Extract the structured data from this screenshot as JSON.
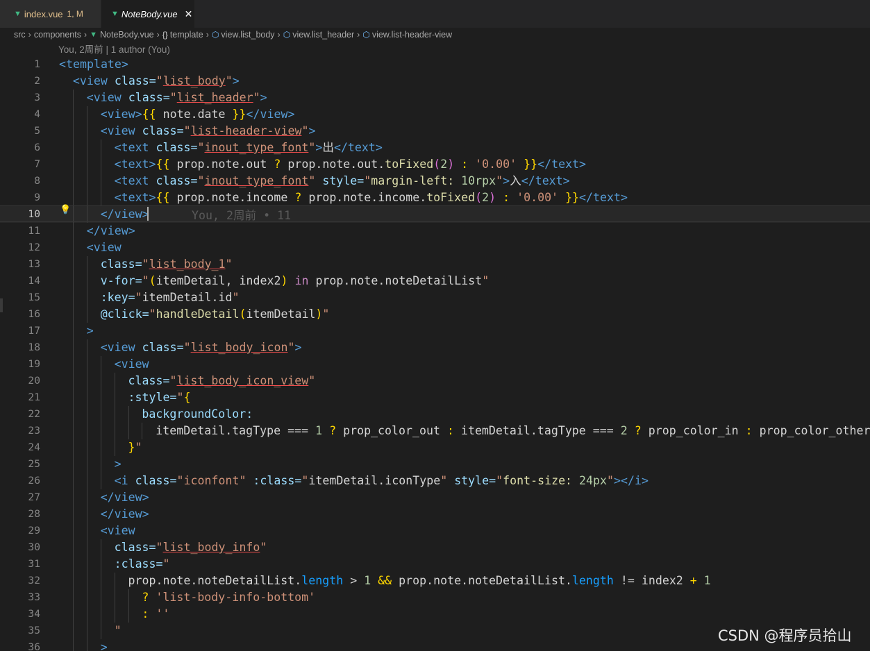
{
  "tabs": [
    {
      "icon": "vue-icon",
      "label": "index.vue",
      "status": "1, M"
    },
    {
      "icon": "vue-icon",
      "label": "NoteBody.vue",
      "close": "✕"
    }
  ],
  "breadcrumb": [
    "src",
    "components",
    "NoteBody.vue",
    "template",
    "view.list_body",
    "view.list_header",
    "view.list-header-view"
  ],
  "codelens": "You, 2周前 | 1 author (You)",
  "current_line": 10,
  "inline_blame": "You, 2周前 • 11",
  "watermark": "CSDN @程序员拾山",
  "code_lines": [
    [
      [
        "<template>",
        "t"
      ]
    ],
    [
      [
        "<view ",
        "t"
      ],
      [
        "class=",
        "a"
      ],
      [
        "\"",
        "s"
      ],
      [
        "list_body",
        "u"
      ],
      [
        "\"",
        "s"
      ],
      [
        ">",
        "t"
      ]
    ],
    [
      [
        "<view ",
        "t"
      ],
      [
        "class=",
        "a"
      ],
      [
        "\"",
        "s"
      ],
      [
        "list_header",
        "u"
      ],
      [
        "\"",
        "s"
      ],
      [
        ">",
        "t"
      ]
    ],
    [
      [
        "<view>",
        "t"
      ],
      [
        "{{",
        "y"
      ],
      [
        " note.date ",
        "p"
      ],
      [
        "}}",
        "y"
      ],
      [
        "</view>",
        "t"
      ]
    ],
    [
      [
        "<view ",
        "t"
      ],
      [
        "class=",
        "a"
      ],
      [
        "\"",
        "s"
      ],
      [
        "list-header-view",
        "u"
      ],
      [
        "\"",
        "s"
      ],
      [
        ">",
        "t"
      ]
    ],
    [
      [
        "<text ",
        "t"
      ],
      [
        "class=",
        "a"
      ],
      [
        "\"",
        "s"
      ],
      [
        "inout_type_font",
        "u"
      ],
      [
        "\"",
        "s"
      ],
      [
        ">",
        "t"
      ],
      [
        "出",
        "p"
      ],
      [
        "</text>",
        "t"
      ]
    ],
    [
      [
        "<text>",
        "t"
      ],
      [
        "{{",
        "y"
      ],
      [
        " prop.note.out ",
        "p"
      ],
      [
        "?",
        "y"
      ],
      [
        " prop.note.out.",
        "p"
      ],
      [
        "toFixed",
        "f"
      ],
      [
        "(",
        "b"
      ],
      [
        "2",
        "n"
      ],
      [
        ")",
        "b"
      ],
      [
        " : ",
        "y"
      ],
      [
        "'0.00'",
        "s"
      ],
      [
        " ",
        "p"
      ],
      [
        "}}",
        "y"
      ],
      [
        "</text>",
        "t"
      ]
    ],
    [
      [
        "<text ",
        "t"
      ],
      [
        "class=",
        "a"
      ],
      [
        "\"",
        "s"
      ],
      [
        "inout_type_font",
        "u"
      ],
      [
        "\"",
        "s"
      ],
      [
        " style=",
        "a"
      ],
      [
        "\"",
        "s"
      ],
      [
        "margin-left: ",
        "f"
      ],
      [
        "10rpx",
        "n"
      ],
      [
        "\"",
        "s"
      ],
      [
        ">",
        "t"
      ],
      [
        "入",
        "p"
      ],
      [
        "</text>",
        "t"
      ]
    ],
    [
      [
        "<text>",
        "t"
      ],
      [
        "{{",
        "y"
      ],
      [
        " prop.note.income ",
        "p"
      ],
      [
        "?",
        "y"
      ],
      [
        " prop.note.income.",
        "p"
      ],
      [
        "toFixed",
        "f"
      ],
      [
        "(",
        "b"
      ],
      [
        "2",
        "n"
      ],
      [
        ")",
        "b"
      ],
      [
        " : ",
        "y"
      ],
      [
        "'0.00'",
        "s"
      ],
      [
        " ",
        "p"
      ],
      [
        "}}",
        "y"
      ],
      [
        "</text>",
        "t"
      ]
    ],
    [
      [
        "</view>",
        "t"
      ]
    ],
    [
      [
        "</view>",
        "t"
      ]
    ],
    [
      [
        "<view",
        "t"
      ]
    ],
    [
      [
        "class=",
        "a"
      ],
      [
        "\"",
        "s"
      ],
      [
        "list_body_1",
        "u"
      ],
      [
        "\"",
        "s"
      ]
    ],
    [
      [
        "v-for=",
        "a"
      ],
      [
        "\"",
        "s"
      ],
      [
        "(",
        "y"
      ],
      [
        "itemDetail, index2",
        ""
      ],
      [
        ")",
        "y"
      ],
      [
        " in ",
        "k"
      ],
      [
        "prop.note.noteDetailList",
        ""
      ],
      [
        "\"",
        "s"
      ]
    ],
    [
      [
        ":key=",
        "a"
      ],
      [
        "\"",
        "s"
      ],
      [
        "itemDetail.id",
        "p"
      ],
      [
        "\"",
        "s"
      ]
    ],
    [
      [
        "@click=",
        "a"
      ],
      [
        "\"",
        "s"
      ],
      [
        "handleDetail",
        "f"
      ],
      [
        "(",
        "y"
      ],
      [
        "itemDetail",
        "p"
      ],
      [
        ")",
        "y"
      ],
      [
        "\"",
        "s"
      ]
    ],
    [
      [
        ">",
        "t"
      ]
    ],
    [
      [
        "<view ",
        "t"
      ],
      [
        "class=",
        "a"
      ],
      [
        "\"",
        "s"
      ],
      [
        "list_body_icon",
        "u"
      ],
      [
        "\"",
        "s"
      ],
      [
        ">",
        "t"
      ]
    ],
    [
      [
        "<view",
        "t"
      ]
    ],
    [
      [
        "class=",
        "a"
      ],
      [
        "\"",
        "s"
      ],
      [
        "list_body_icon_view",
        "u"
      ],
      [
        "\"",
        "s"
      ]
    ],
    [
      [
        ":style=",
        "a"
      ],
      [
        "\"",
        "s"
      ],
      [
        "{",
        "y"
      ]
    ],
    [
      [
        "backgroundColor:",
        "a"
      ]
    ],
    [
      [
        "itemDetail.tagType ",
        "p"
      ],
      [
        "===",
        "p"
      ],
      [
        " ",
        "p"
      ],
      [
        "1",
        "n"
      ],
      [
        " ",
        "p"
      ],
      [
        "?",
        "y"
      ],
      [
        " prop_color_out ",
        "p"
      ],
      [
        ":",
        "y"
      ],
      [
        " itemDetail.tagType ",
        "p"
      ],
      [
        "===",
        "p"
      ],
      [
        " ",
        "p"
      ],
      [
        "2",
        "n"
      ],
      [
        " ",
        "p"
      ],
      [
        "?",
        "y"
      ],
      [
        " prop_color_in ",
        "p"
      ],
      [
        ":",
        "y"
      ],
      [
        " prop_color_other,",
        "p"
      ]
    ],
    [
      [
        "}",
        "y"
      ],
      [
        "\"",
        "s"
      ]
    ],
    [
      [
        ">",
        "t"
      ]
    ],
    [
      [
        "<i ",
        "t"
      ],
      [
        "class=",
        "a"
      ],
      [
        "\"iconfont\"",
        "s"
      ],
      [
        " :class=",
        "a"
      ],
      [
        "\"",
        "s"
      ],
      [
        "itemDetail.iconType",
        "p"
      ],
      [
        "\"",
        "s"
      ],
      [
        " style=",
        "a"
      ],
      [
        "\"",
        "s"
      ],
      [
        "font-size: ",
        "f"
      ],
      [
        "24px",
        "n"
      ],
      [
        "\"",
        "s"
      ],
      [
        "></i>",
        "t"
      ]
    ],
    [
      [
        "</view>",
        "t"
      ]
    ],
    [
      [
        "</view>",
        "t"
      ]
    ],
    [
      [
        "<view",
        "t"
      ]
    ],
    [
      [
        "class=",
        "a"
      ],
      [
        "\"",
        "s"
      ],
      [
        "list_body_info",
        "u"
      ],
      [
        "\"",
        "s"
      ]
    ],
    [
      [
        ":class=",
        "a"
      ],
      [
        "\"",
        "s"
      ]
    ],
    [
      [
        "prop.note.noteDetailList.",
        "p"
      ],
      [
        "length",
        "d"
      ],
      [
        " > ",
        "p"
      ],
      [
        "1",
        "n"
      ],
      [
        " && ",
        "y"
      ],
      [
        "prop.note.noteDetailList.",
        "p"
      ],
      [
        "length",
        "d"
      ],
      [
        " != ",
        "p"
      ],
      [
        "index2 ",
        "p"
      ],
      [
        "+ ",
        "y"
      ],
      [
        "1",
        "n"
      ]
    ],
    [
      [
        "? ",
        "y"
      ],
      [
        "'list-body-info-bottom'",
        "s"
      ]
    ],
    [
      [
        ": ",
        "y"
      ],
      [
        "''",
        "s"
      ]
    ],
    [
      [
        "\"",
        "s"
      ]
    ],
    [
      [
        ">",
        "t"
      ]
    ]
  ],
  "colors": {
    "background": "#1e1e1e",
    "tag": "#569cd6",
    "attr": "#9cdcfe",
    "string": "#ce9178",
    "bracket": "#ffd700",
    "fn": "#dcdcaa",
    "number": "#b5cea8"
  }
}
